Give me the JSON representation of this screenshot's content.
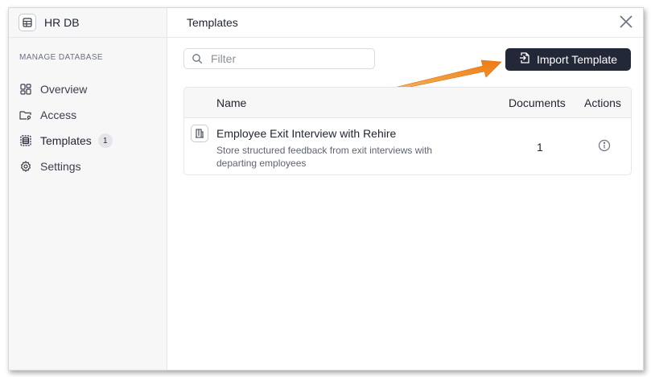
{
  "sidebar": {
    "db_name": "HR DB",
    "section_label": "MANAGE DATABASE",
    "items": [
      {
        "label": "Overview",
        "icon": "overview-icon"
      },
      {
        "label": "Access",
        "icon": "folder-access-icon"
      },
      {
        "label": "Templates",
        "icon": "templates-icon",
        "badge": "1",
        "active": true
      },
      {
        "label": "Settings",
        "icon": "gear-icon"
      }
    ]
  },
  "main": {
    "title": "Templates",
    "filter_placeholder": "Filter",
    "import_label": "Import Template",
    "table": {
      "headers": {
        "name": "Name",
        "documents": "Documents",
        "actions": "Actions"
      },
      "rows": [
        {
          "name": "Employee Exit Interview with Rehire",
          "description": "Store structured feedback from exit interviews with departing employees",
          "documents": "1"
        }
      ]
    }
  },
  "colors": {
    "accent_button": "#232838",
    "annotation_arrow": "#f08a1c",
    "sidebar_bg": "#f7f7f8"
  }
}
